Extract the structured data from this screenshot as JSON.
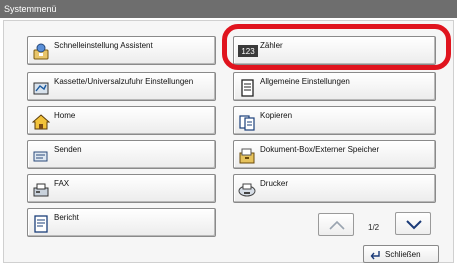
{
  "window": {
    "title": "Systemmenü"
  },
  "menu": {
    "left": [
      {
        "label": "Schnelleinstellung Assistent",
        "icon": "wizard-icon"
      },
      {
        "label": "Kassette/Universalzufuhr Einstellungen",
        "icon": "paper-tray-icon"
      },
      {
        "label": "Home",
        "icon": "home-icon"
      },
      {
        "label": "Senden",
        "icon": "send-icon"
      },
      {
        "label": "FAX",
        "icon": "fax-icon"
      },
      {
        "label": "Bericht",
        "icon": "report-icon"
      }
    ],
    "right": [
      {
        "label": "Zähler",
        "icon": "counter-icon",
        "icon_text": "123",
        "highlighted": true
      },
      {
        "label": "Allgemeine Einstellungen",
        "icon": "settings-document-icon"
      },
      {
        "label": "Kopieren",
        "icon": "copy-icon"
      },
      {
        "label": "Dokument-Box/Externer Speicher",
        "icon": "document-box-icon"
      },
      {
        "label": "Drucker",
        "icon": "printer-icon"
      }
    ]
  },
  "pagination": {
    "current": "1/2"
  },
  "footer": {
    "close_label": "Schließen"
  },
  "colors": {
    "highlight": "#e0141e",
    "titlebar": "#6e6e6e"
  }
}
